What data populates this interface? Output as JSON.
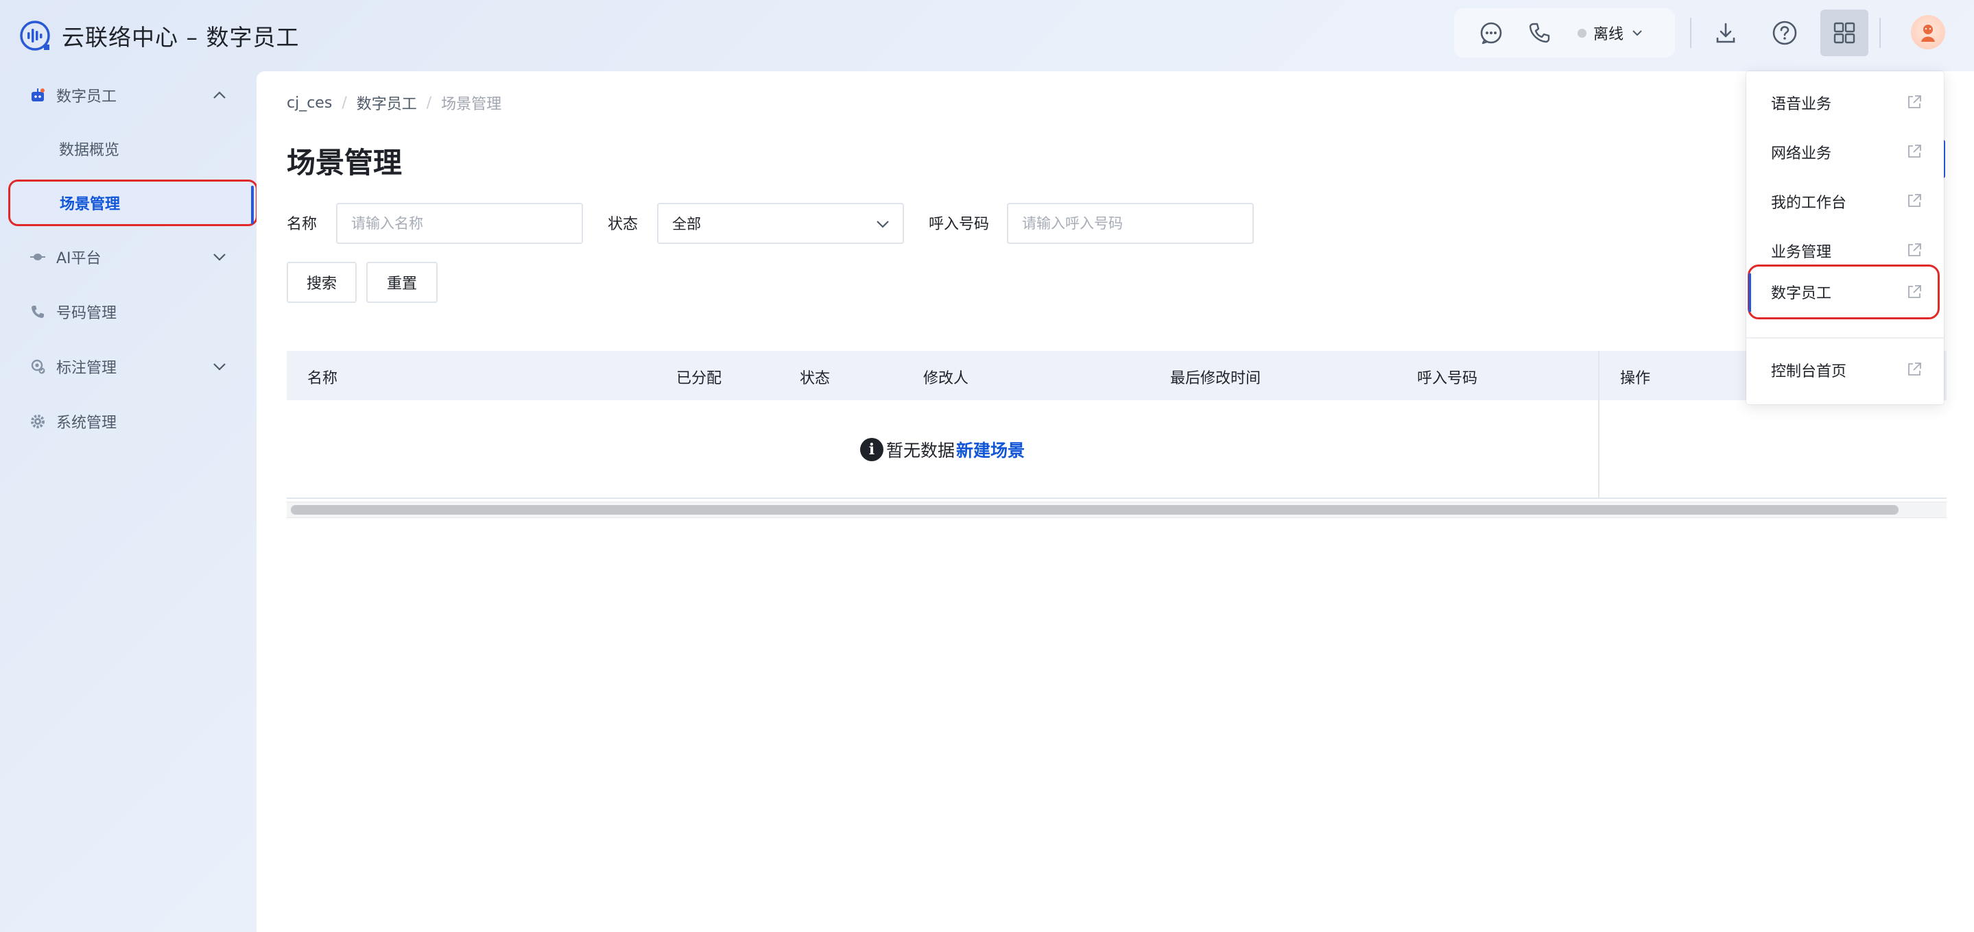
{
  "app": {
    "title": "云联络中心 – 数字员工"
  },
  "topbar": {
    "status_label": "离线",
    "icons": [
      "chat-icon",
      "phone-icon",
      "download-icon",
      "help-icon",
      "apps-grid-icon"
    ]
  },
  "sidebar": {
    "items": [
      {
        "label": "数字员工",
        "icon": "digital-employee-icon",
        "expanded": true
      },
      {
        "label": "数据概览",
        "sub": true
      },
      {
        "label": "场景管理",
        "sub": true,
        "active": true
      },
      {
        "label": "AI平台",
        "icon": "ai-platform-icon",
        "expanded": false
      },
      {
        "label": "号码管理",
        "icon": "phone-number-icon"
      },
      {
        "label": "标注管理",
        "icon": "annotation-icon",
        "expanded": false
      },
      {
        "label": "系统管理",
        "icon": "settings-icon"
      }
    ]
  },
  "breadcrumb": [
    "cj_ces",
    "数字员工",
    "场景管理"
  ],
  "page": {
    "title": "场景管理"
  },
  "filters": {
    "name_label": "名称",
    "name_placeholder": "请输入名称",
    "status_label": "状态",
    "status_value": "全部",
    "number_label": "呼入号码",
    "number_placeholder": "请输入呼入号码"
  },
  "buttons": {
    "search": "搜索",
    "reset": "重置"
  },
  "table": {
    "columns": [
      "名称",
      "已分配",
      "状态",
      "修改人",
      "最后修改时间",
      "呼入号码",
      "操作"
    ],
    "empty_text": "暂无数据",
    "empty_link": "新建场景"
  },
  "dropdown": {
    "items": [
      "语音业务",
      "网络业务",
      "我的工作台",
      "业务管理",
      "数字员工",
      "控制台首页"
    ],
    "highlighted": "数字员工"
  },
  "colors": {
    "accent": "#1256d8",
    "highlight_border": "#e02a2a",
    "table_header_bg": "#eef2f8"
  }
}
